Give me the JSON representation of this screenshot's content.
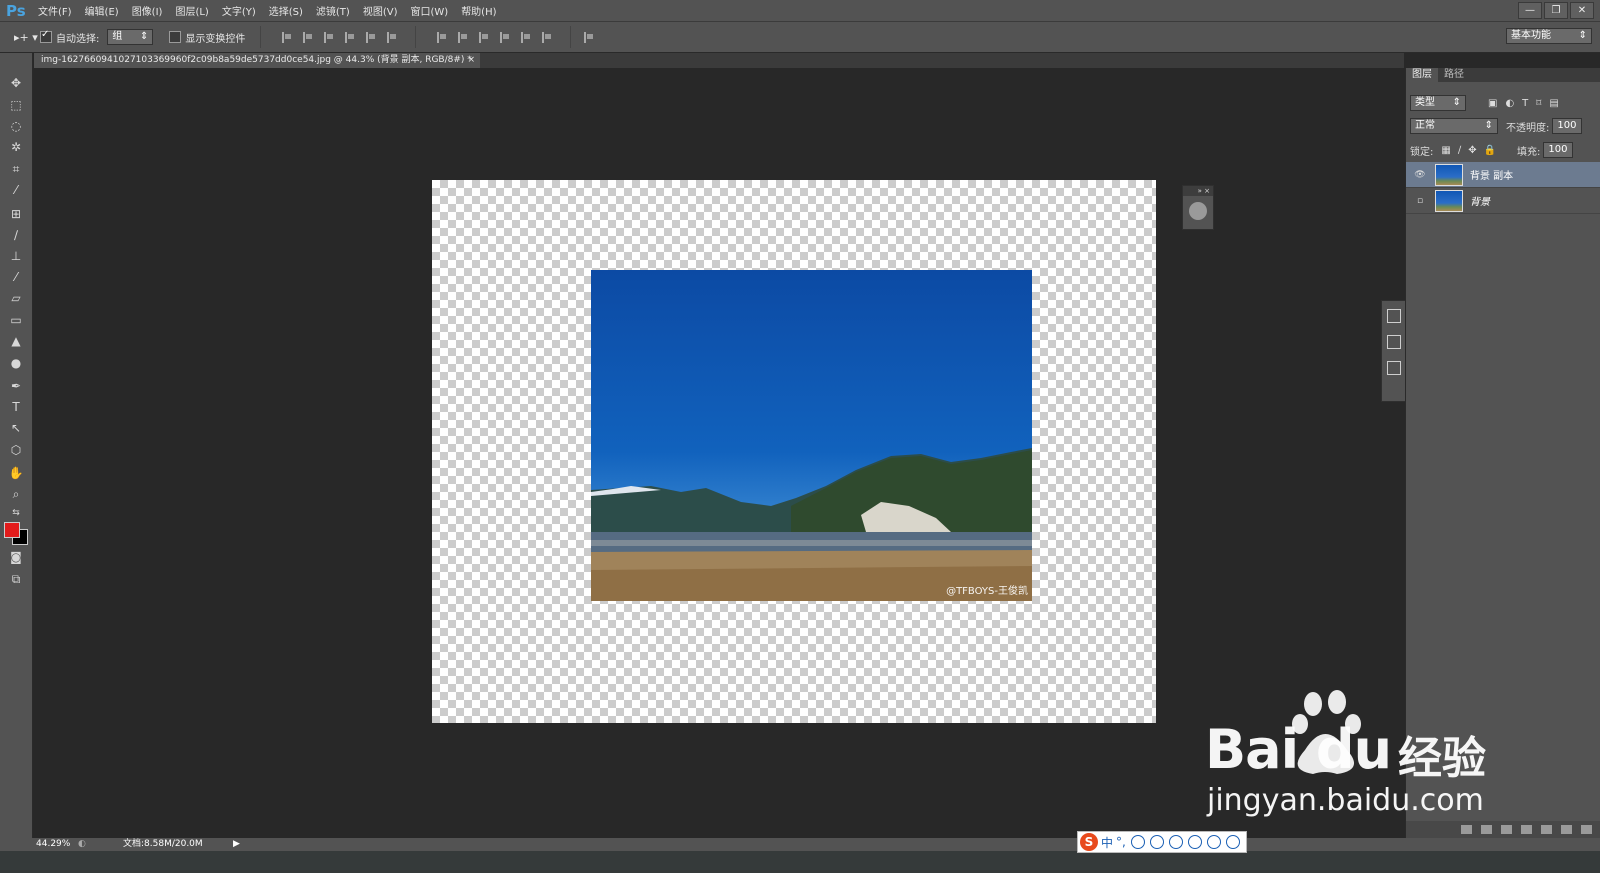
{
  "app": {
    "logo": "Ps"
  },
  "menus": [
    "文件(F)",
    "编辑(E)",
    "图像(I)",
    "图层(L)",
    "文字(Y)",
    "选择(S)",
    "滤镜(T)",
    "视图(V)",
    "窗口(W)",
    "帮助(H)"
  ],
  "window_controls": [
    "—",
    "❐",
    "✕"
  ],
  "options": {
    "tool_icon": "move-icon",
    "auto_select_label": "自动选择:",
    "auto_select_checked": true,
    "auto_select_value": "组",
    "transform_label": "显示变换控件",
    "transform_checked": false,
    "workspace": "基本功能"
  },
  "document": {
    "tab_title": "img-16276609410271033699­60f2c09b8a59de5737dd0ce54.jpg @ 44.3% (背景 副本, RGB/8#) *",
    "close": "×",
    "watermark": "@TFBOYS-王俊凯"
  },
  "layers_panel": {
    "tabs": [
      "图层",
      "路径"
    ],
    "filter_kind": "类型",
    "blend_mode": "正常",
    "opacity_label": "不透明度:",
    "opacity_value": "100",
    "lock_label": "锁定:",
    "fill_label": "填充:",
    "fill_value": "100",
    "layers": [
      {
        "name": "背景 副本",
        "visible": true,
        "selected": true
      },
      {
        "name": "背景",
        "visible": false,
        "selected": false
      }
    ],
    "footer_icons": [
      "link-icon",
      "fx-icon",
      "mask-icon",
      "adjustment-icon",
      "folder-icon",
      "new-layer-icon",
      "trash-icon"
    ]
  },
  "status": {
    "zoom": "44.29%",
    "doc_info": "文档:8.58M/20.0M"
  },
  "ime": {
    "logo": "S",
    "lang": "中",
    "punct": "°,"
  },
  "watermark_site": {
    "brand": "Bai du",
    "brand_suffix": "经验",
    "url": "jingyan.baidu.com"
  },
  "colors": {
    "foreground": "#e31c1c",
    "background": "#000000",
    "ui_dark": "#282828",
    "ui_panel": "#535353",
    "selected_layer": "#6c7b90"
  }
}
